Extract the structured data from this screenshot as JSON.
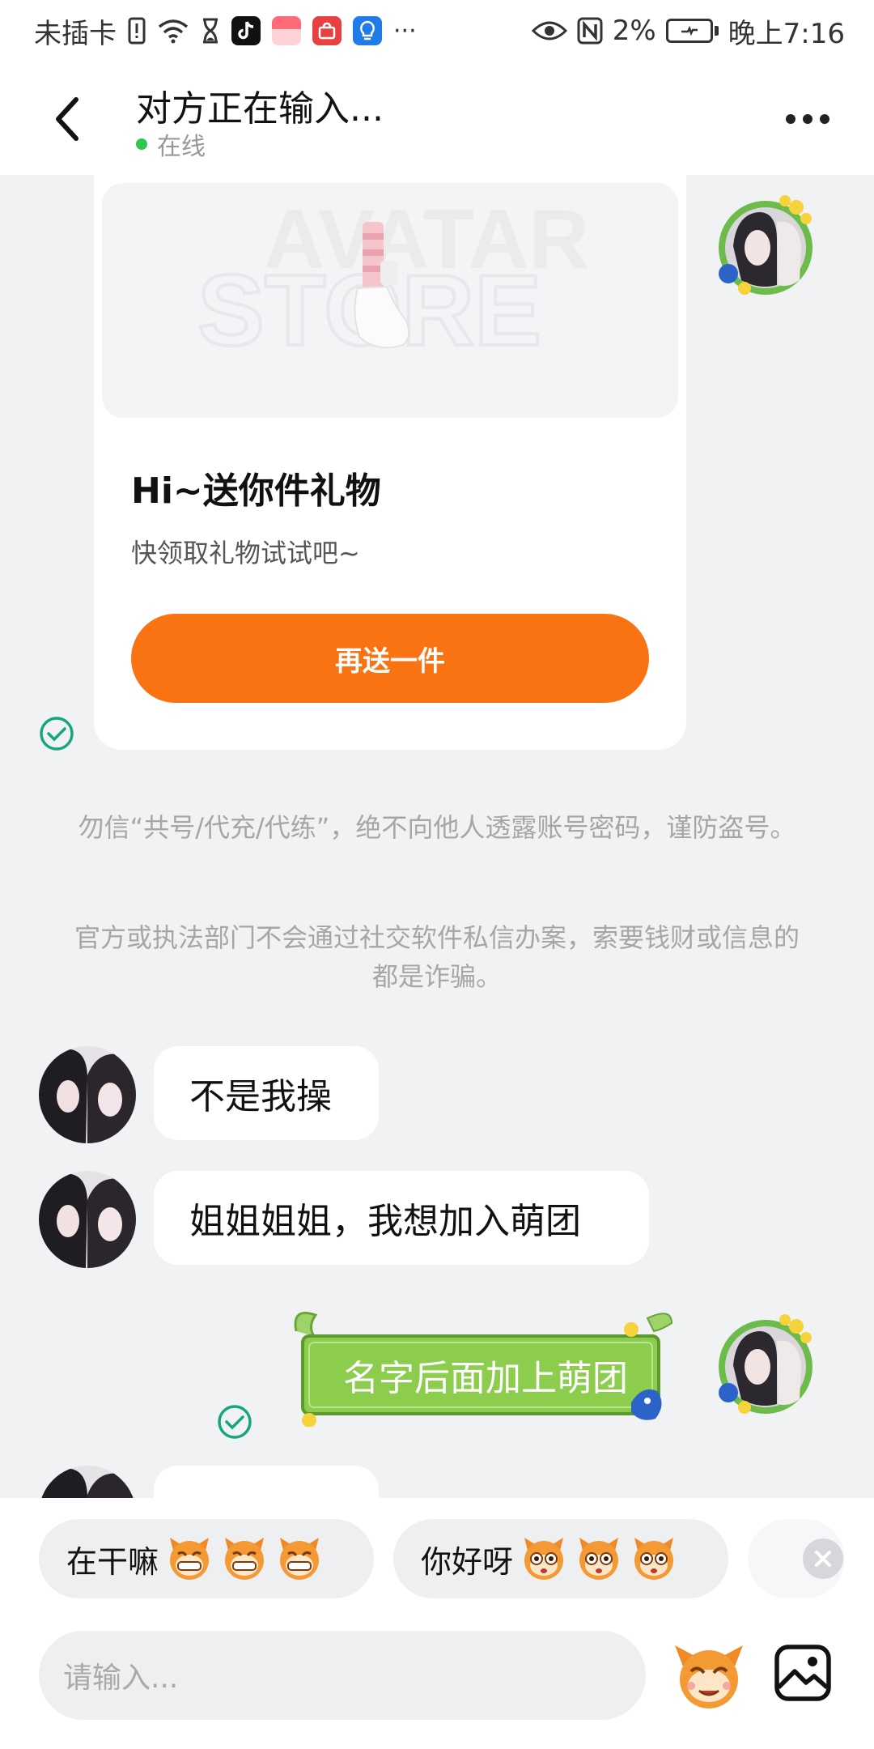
{
  "status_bar": {
    "carrier": "未插卡",
    "battery_pct": "2%",
    "time": "晚上7:16",
    "icons": [
      "sim-alert-icon",
      "wifi-icon",
      "hourglass-icon",
      "tiktok-icon",
      "app-red-icon",
      "shop-icon",
      "bulb-icon",
      "more-notif-icon",
      "eye-icon",
      "nfc-icon",
      "battery-icon"
    ],
    "more": "···"
  },
  "header": {
    "title": "对方正在输入...",
    "status": "在线",
    "online_color": "#2dc84d"
  },
  "gift_card": {
    "watermark_line1": "AVATAR",
    "watermark_line2": "STORE",
    "title": "Hi~送你件礼物",
    "subtitle": "快领取礼物试试吧~",
    "button_label": "再送一件",
    "button_color": "#f97312"
  },
  "notices": [
    "勿信“共号/代充/代练”，绝不向他人透露账号密码，谨防盗号。",
    "官方或执法部门不会通过社交软件私信办案，索要钱财或信息的都是诈骗。"
  ],
  "messages": [
    {
      "from": "other",
      "text": "不是我操"
    },
    {
      "from": "other",
      "text": "姐姐姐姐，我想加入萌团"
    },
    {
      "from": "self",
      "text": "名字后面加上萌团",
      "bubble_color": "#8ccd4e"
    }
  ],
  "quick_replies": [
    {
      "text": "在干嘛"
    },
    {
      "text": "你好呀"
    }
  ],
  "input": {
    "placeholder": "请输入..."
  }
}
